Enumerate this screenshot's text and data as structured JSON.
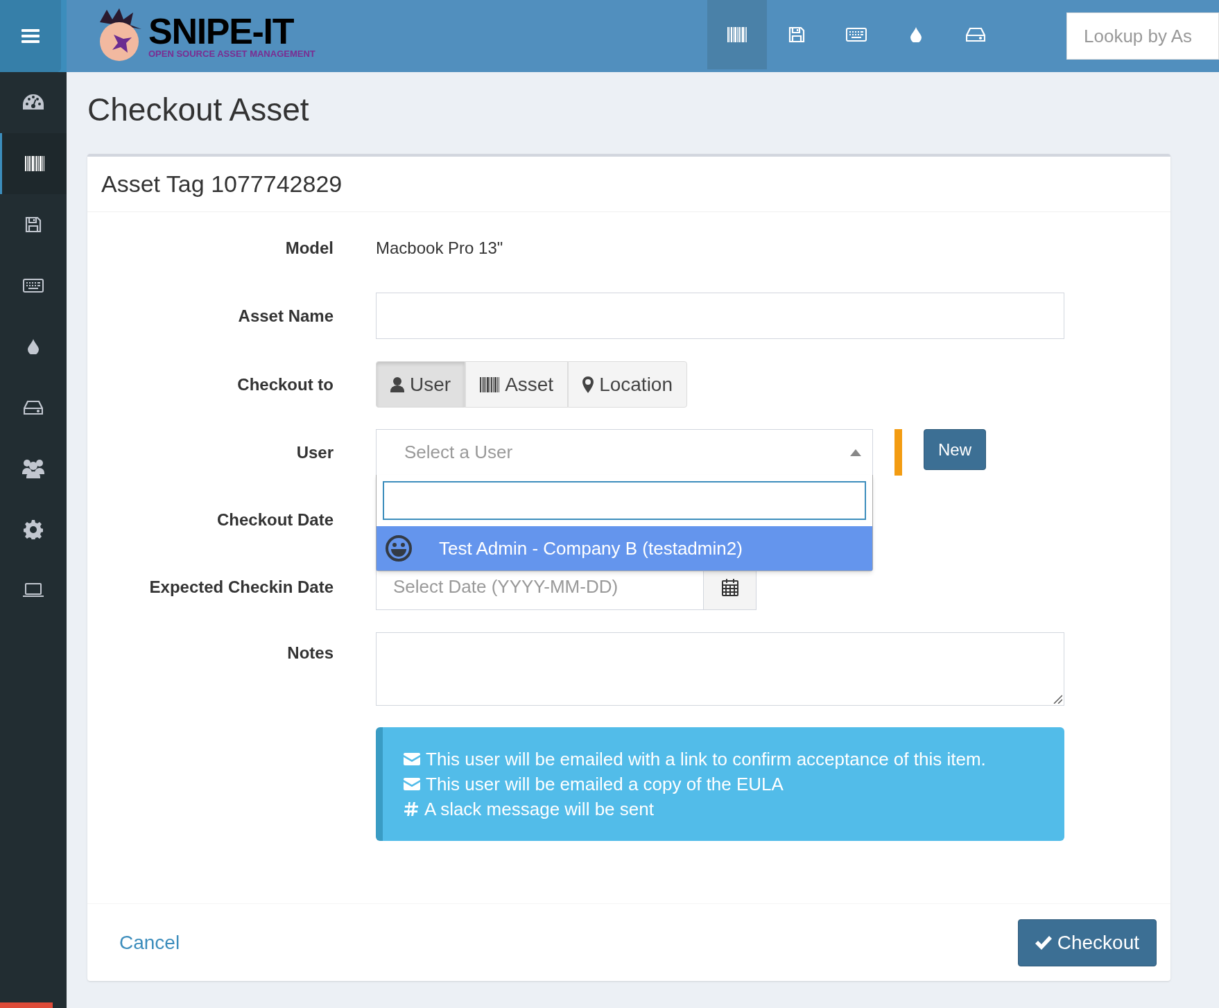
{
  "header": {
    "logo_title": "SNIPE-IT",
    "logo_subtitle": "OPEN SOURCE ASSET MANAGEMENT",
    "nav": [
      {
        "kind": "barcode",
        "selected": true
      },
      {
        "kind": "floppy",
        "selected": false
      },
      {
        "kind": "keyboard",
        "selected": false
      },
      {
        "kind": "drop",
        "selected": false
      },
      {
        "kind": "drive",
        "selected": false
      }
    ],
    "search": {
      "placeholder": "Lookup by As"
    }
  },
  "sidebar": {
    "items": [
      {
        "kind": "dashboard",
        "selected": false
      },
      {
        "kind": "barcode",
        "selected": true
      },
      {
        "kind": "floppy",
        "selected": false
      },
      {
        "kind": "keyboard",
        "selected": false
      },
      {
        "kind": "drop",
        "selected": false
      },
      {
        "kind": "drive",
        "selected": false
      },
      {
        "kind": "users",
        "selected": false
      },
      {
        "kind": "gear",
        "selected": false
      },
      {
        "kind": "laptop",
        "selected": false
      }
    ]
  },
  "page_title": "Checkout Asset",
  "card": {
    "title": "Asset Tag 1077742829",
    "model": {
      "label": "Model",
      "value": "Macbook Pro 13\""
    },
    "asset_name": {
      "label": "Asset Name"
    },
    "checkout_to": {
      "label": "Checkout to",
      "options": [
        {
          "kind": "user",
          "label": "User",
          "selected": true
        },
        {
          "kind": "barcode",
          "label": "Asset",
          "selected": false
        },
        {
          "kind": "pin",
          "label": "Location",
          "selected": false
        }
      ]
    },
    "user": {
      "label": "User",
      "placeholder": "Select a User",
      "expanded": true,
      "new_button": "New",
      "options": [
        {
          "label": "Test Admin - Company B (testadmin2)",
          "selected": true
        }
      ]
    },
    "checkout_date": {
      "label": "Checkout Date"
    },
    "expected_checkin": {
      "label": "Expected Checkin Date",
      "placeholder": "Select Date (YYYY-MM-DD)"
    },
    "notes": {
      "label": "Notes"
    },
    "alert": [
      {
        "kind": "envelope",
        "text": "This user will be emailed with a link to confirm acceptance of this item."
      },
      {
        "kind": "envelope",
        "text": "This user will be emailed a copy of the EULA"
      },
      {
        "kind": "slack",
        "text": "A slack message will be sent"
      }
    ],
    "cancel": "Cancel",
    "submit": "Checkout"
  }
}
